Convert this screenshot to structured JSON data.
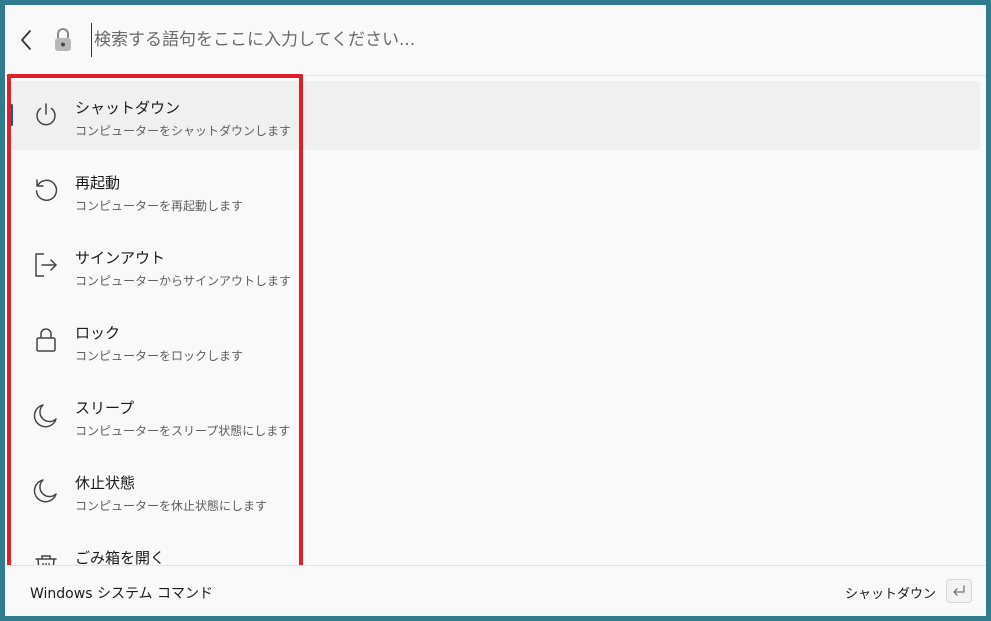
{
  "search": {
    "placeholder": "検索する語句をここに入力してください..."
  },
  "results": [
    {
      "title": "シャットダウン",
      "subtitle": "コンピューターをシャットダウンします",
      "icon": "power-icon",
      "selected": true
    },
    {
      "title": "再起動",
      "subtitle": "コンピューターを再起動します",
      "icon": "restart-icon"
    },
    {
      "title": "サインアウト",
      "subtitle": "コンピューターからサインアウトします",
      "icon": "sign-out-icon"
    },
    {
      "title": "ロック",
      "subtitle": "コンピューターをロックします",
      "icon": "lock-icon"
    },
    {
      "title": "スリープ",
      "subtitle": "コンピューターをスリープ状態にします",
      "icon": "moon-icon"
    },
    {
      "title": "休止状態",
      "subtitle": "コンピューターを休止状態にします",
      "icon": "moon-icon"
    },
    {
      "title": "ごみ箱を開く",
      "subtitle": "",
      "icon": "trash-icon"
    }
  ],
  "footer": {
    "plugin_name": "Windows システム コマンド",
    "action_label": "シャットダウン",
    "key_icon": "enter-key-icon"
  },
  "colors": {
    "accent": "#0a5bb0",
    "highlight_border": "#e01f2a",
    "frame": "#2e7c8d"
  }
}
